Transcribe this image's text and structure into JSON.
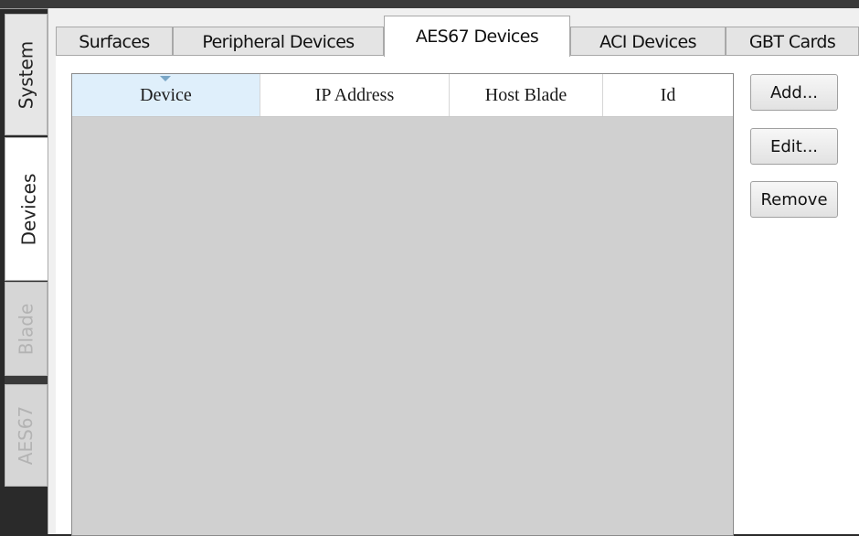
{
  "side_tabs": [
    {
      "label": "System",
      "state": "normal"
    },
    {
      "label": "Devices",
      "state": "active"
    },
    {
      "label": "Blade",
      "state": "disabled"
    },
    {
      "label": "AES67",
      "state": "disabled"
    }
  ],
  "top_tabs": [
    {
      "label": "Surfaces"
    },
    {
      "label": "Peripheral Devices"
    },
    {
      "label": "AES67 Devices",
      "active": true
    },
    {
      "label": "ACI Devices"
    },
    {
      "label": "GBT Cards"
    }
  ],
  "table": {
    "columns": [
      "Device",
      "IP Address",
      "Host Blade",
      "Id"
    ],
    "sorted_column": "Device",
    "rows": []
  },
  "buttons": {
    "add": "Add...",
    "edit": "Edit...",
    "remove": "Remove"
  }
}
